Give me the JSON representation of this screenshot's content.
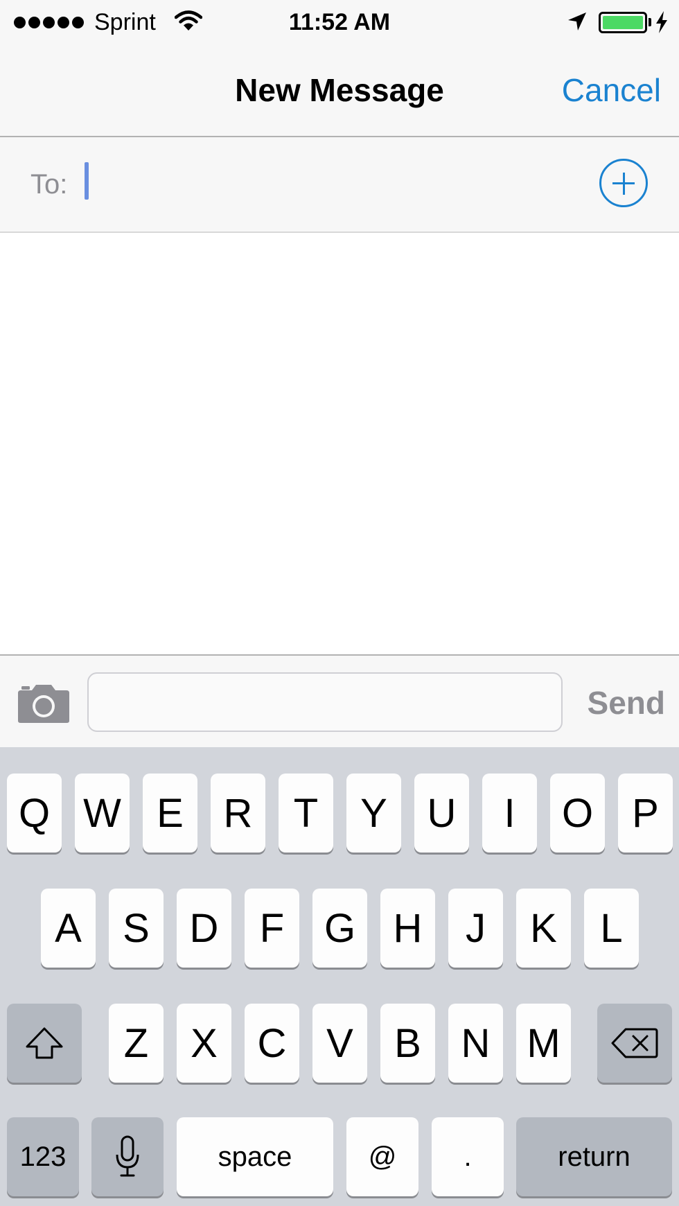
{
  "status_bar": {
    "carrier": "Sprint",
    "time": "11:52 AM",
    "signal_dots": 5,
    "battery_level": 1.0,
    "battery_color": "#4cd964",
    "icons": [
      "signal-dots",
      "wifi-icon",
      "location-arrow-icon",
      "battery-icon",
      "charging-bolt-icon"
    ]
  },
  "nav": {
    "title": "New Message",
    "cancel_label": "Cancel",
    "accent_color": "#1a82d0"
  },
  "to_field": {
    "label": "To:",
    "value": "",
    "add_icon": "plus-circle-icon"
  },
  "compose": {
    "camera_icon": "camera-icon",
    "message_value": "",
    "send_label": "Send"
  },
  "keyboard": {
    "row1": [
      "Q",
      "W",
      "E",
      "R",
      "T",
      "Y",
      "U",
      "I",
      "O",
      "P"
    ],
    "row2": [
      "A",
      "S",
      "D",
      "F",
      "G",
      "H",
      "J",
      "K",
      "L"
    ],
    "row3": [
      "Z",
      "X",
      "C",
      "V",
      "B",
      "N",
      "M"
    ],
    "shift_icon": "shift-arrow-icon",
    "delete_icon": "backspace-icon",
    "numbers_label": "123",
    "mic_icon": "microphone-icon",
    "space_label": "space",
    "at_label": "@",
    "period_label": ".",
    "return_label": "return"
  }
}
